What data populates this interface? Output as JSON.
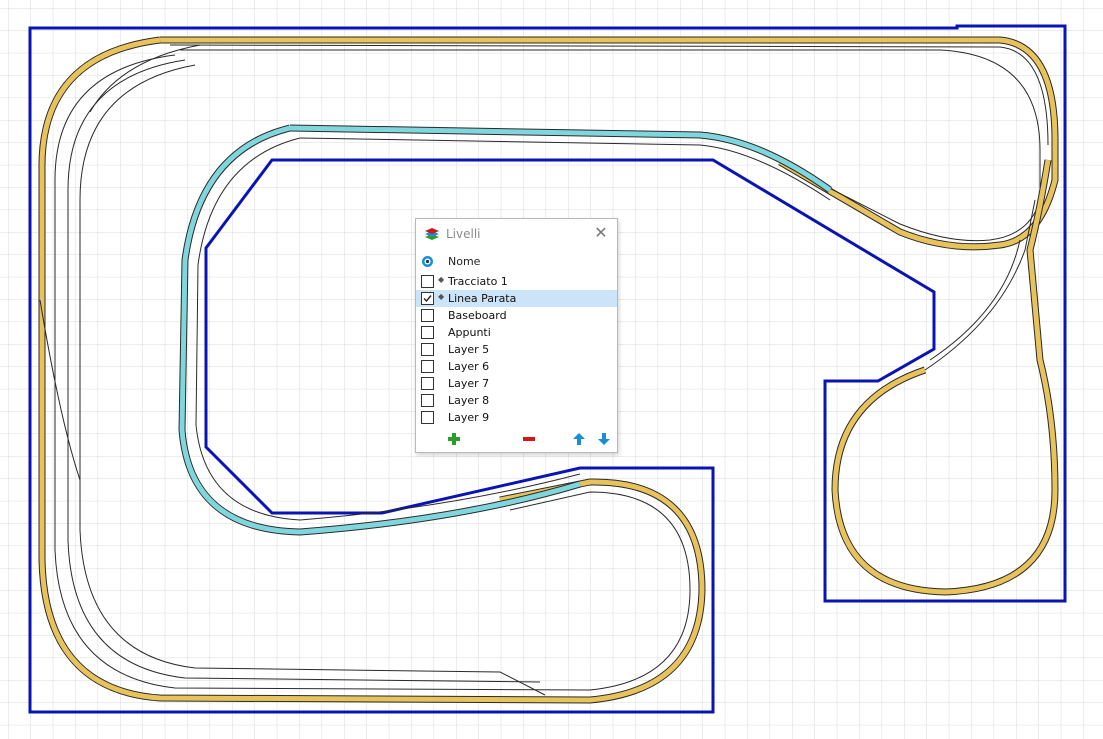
{
  "window": {
    "title": "Livelli",
    "close_glyph": "✕"
  },
  "header": {
    "name_label": "Nome"
  },
  "layers": [
    {
      "label": "Tracciato 1",
      "checked": false,
      "active_dot": true,
      "selected": false
    },
    {
      "label": "Linea Parata",
      "checked": true,
      "active_dot": true,
      "selected": true
    },
    {
      "label": "Baseboard",
      "checked": false,
      "active_dot": false,
      "selected": false
    },
    {
      "label": "Appunti",
      "checked": false,
      "active_dot": false,
      "selected": false
    },
    {
      "label": "Layer 5",
      "checked": false,
      "active_dot": false,
      "selected": false
    },
    {
      "label": "Layer 6",
      "checked": false,
      "active_dot": false,
      "selected": false
    },
    {
      "label": "Layer 7",
      "checked": false,
      "active_dot": false,
      "selected": false
    },
    {
      "label": "Layer 8",
      "checked": false,
      "active_dot": false,
      "selected": false
    },
    {
      "label": "Layer 9",
      "checked": false,
      "active_dot": false,
      "selected": false
    }
  ],
  "footer": {
    "add_icon": "plus-icon",
    "remove_icon": "minus-icon",
    "up_icon": "arrow-up-icon",
    "down_icon": "arrow-down-icon"
  },
  "colors": {
    "grid": "#d9d9d9",
    "baseboard": "#0a14b4",
    "track_yellow": "#e8c25a",
    "track_cyan": "#7fd6dc",
    "track_rail": "#2a2a2a",
    "selection": "#cce4f7",
    "add_green": "#2a9d2a",
    "remove_red": "#d01818",
    "arrow_blue": "#1a8fd8"
  }
}
